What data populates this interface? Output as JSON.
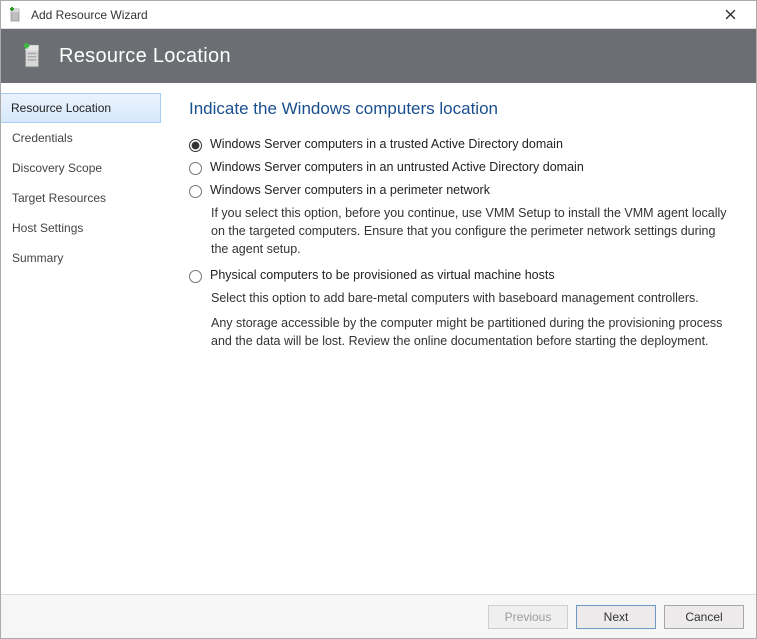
{
  "window": {
    "title": "Add Resource Wizard"
  },
  "header": {
    "title": "Resource Location"
  },
  "sidebar": {
    "items": [
      {
        "label": "Resource Location"
      },
      {
        "label": "Credentials"
      },
      {
        "label": "Discovery Scope"
      },
      {
        "label": "Target Resources"
      },
      {
        "label": "Host Settings"
      },
      {
        "label": "Summary"
      }
    ],
    "selectedIndex": 0
  },
  "content": {
    "heading": "Indicate the Windows computers location",
    "options": [
      {
        "label": "Windows Server computers in a trusted Active Directory domain",
        "selected": true
      },
      {
        "label": "Windows Server computers in an untrusted Active Directory domain",
        "selected": false
      },
      {
        "label": "Windows Server computers in a perimeter network",
        "selected": false,
        "desc": "If you select this option, before you continue, use VMM Setup to install the VMM agent locally on the targeted computers. Ensure that you configure the perimeter network settings during the agent setup."
      },
      {
        "label": "Physical computers to be provisioned as virtual machine hosts",
        "selected": false,
        "desc1": "Select this option to add bare-metal computers with baseboard management controllers.",
        "desc2": "Any storage accessible by the computer might be partitioned during the provisioning process and the data will be lost. Review the online documentation before starting the deployment."
      }
    ]
  },
  "footer": {
    "previous": "Previous",
    "next": "Next",
    "cancel": "Cancel"
  }
}
